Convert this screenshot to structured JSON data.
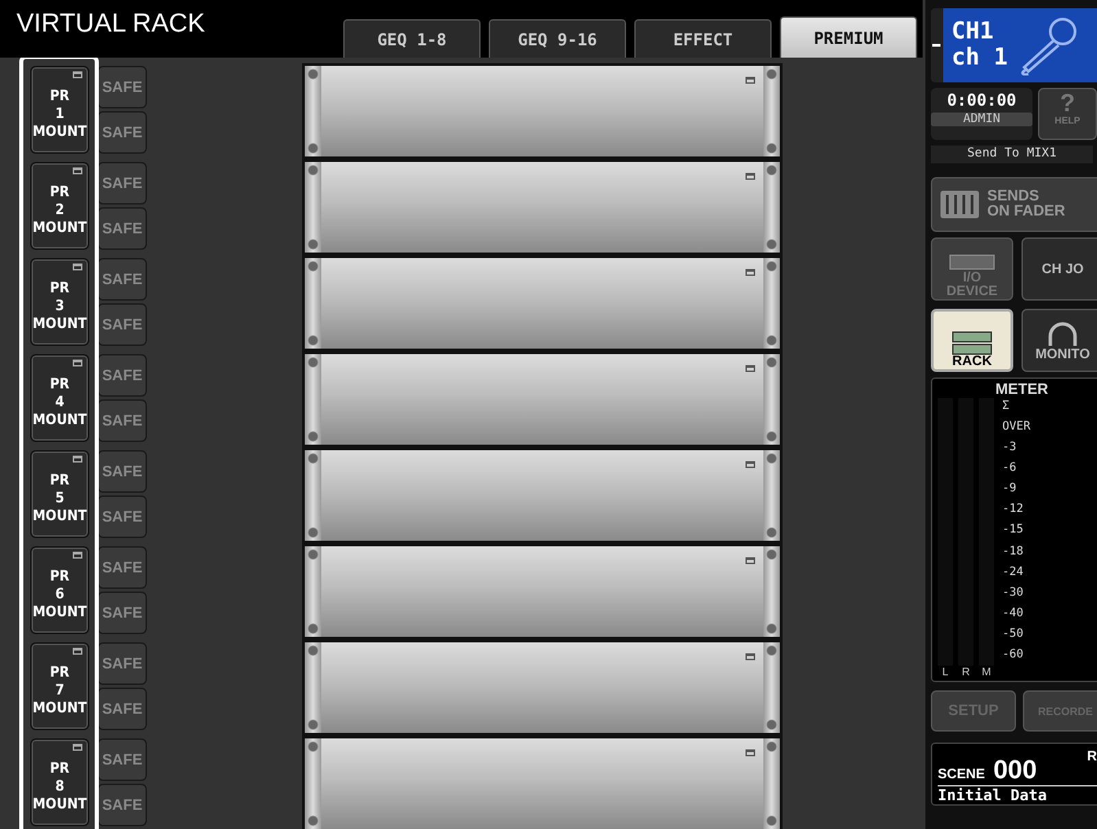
{
  "title": "VIRTUAL RACK",
  "tabs": [
    {
      "label": "GEQ 1-8",
      "selected": false
    },
    {
      "label": "GEQ 9-16",
      "selected": false
    },
    {
      "label": "EFFECT",
      "selected": false
    },
    {
      "label": "PREMIUM",
      "selected": true
    }
  ],
  "racks": [
    {
      "mount": "PR\n1\nMOUNT",
      "safe": [
        "SAFE",
        "SAFE"
      ]
    },
    {
      "mount": "PR\n2\nMOUNT",
      "safe": [
        "SAFE",
        "SAFE"
      ]
    },
    {
      "mount": "PR\n3\nMOUNT",
      "safe": [
        "SAFE",
        "SAFE"
      ]
    },
    {
      "mount": "PR\n4\nMOUNT",
      "safe": [
        "SAFE",
        "SAFE"
      ]
    },
    {
      "mount": "PR\n5\nMOUNT",
      "safe": [
        "SAFE",
        "SAFE"
      ]
    },
    {
      "mount": "PR\n6\nMOUNT",
      "safe": [
        "SAFE",
        "SAFE"
      ]
    },
    {
      "mount": "PR\n7\nMOUNT",
      "safe": [
        "SAFE",
        "SAFE"
      ]
    },
    {
      "mount": "PR\n8\nMOUNT",
      "safe": [
        "SAFE",
        "SAFE"
      ]
    }
  ],
  "channel": {
    "id": "CH1",
    "name": "ch 1"
  },
  "time": "0:00:00",
  "user": "ADMIN",
  "help": {
    "symbol": "?",
    "label": "HELP"
  },
  "send_to": "Send To MIX1",
  "sends_on_fader": "SENDS\nON FADER",
  "nav": [
    {
      "label": "I/O\nDEVICE",
      "kind": "device",
      "selected": false,
      "disabled": true
    },
    {
      "label": "CH JO",
      "kind": "text",
      "selected": false,
      "disabled": false
    },
    {
      "label": "RACK",
      "kind": "rack",
      "selected": true,
      "disabled": false
    },
    {
      "label": "MONITO",
      "kind": "monitor",
      "selected": false,
      "disabled": false
    }
  ],
  "meter": {
    "title": "METER",
    "scale": [
      "Σ",
      "OVER",
      "-3",
      "-6",
      "-9",
      "-12",
      "-15",
      "-18",
      "-24",
      "-30",
      "-40",
      "-50",
      "-60"
    ],
    "channels": [
      "L",
      "R",
      "M"
    ]
  },
  "bottom_buttons": [
    {
      "label": "SETUP",
      "disabled": true
    },
    {
      "label": "RECORDE",
      "disabled": true
    }
  ],
  "scene": {
    "label": "SCENE",
    "number": "000",
    "flag": "R",
    "name": "Initial Data"
  }
}
